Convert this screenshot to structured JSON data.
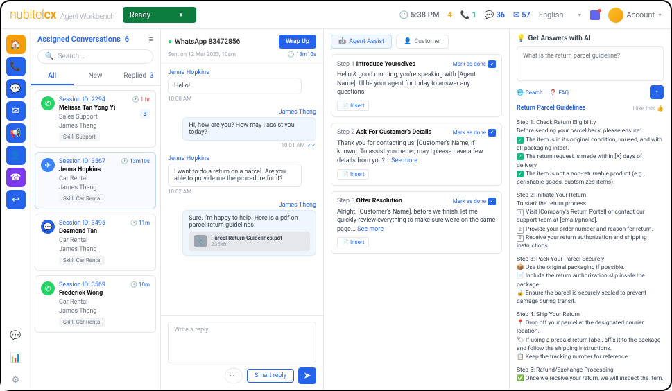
{
  "header": {
    "brand": "nubitel",
    "brand_suffix": "cx",
    "product": "Agent Workbench",
    "status": "Ready",
    "time_label": "5:38 PM",
    "stat_pending": "4",
    "stat_calls": "1",
    "stat_chats": "36",
    "stat_emails": "57",
    "language": "English",
    "account_label": "Account"
  },
  "convs": {
    "title": "Assigned Conversations",
    "count": "6",
    "search_placeholder": "Search...",
    "tabs": {
      "all": "All",
      "new": "New",
      "replied": "Replied",
      "replied_cnt": "3"
    },
    "items": [
      {
        "channel": "wa",
        "session": "Session ID: 2294",
        "time": "1 hr",
        "time_red": true,
        "name": "Melissa Tan Yong Yi",
        "sub1": "Sales Support",
        "sub2": "James Theng",
        "skill": "Skill: Support",
        "unread": "3"
      },
      {
        "channel": "tg",
        "session": "Session ID: 3567",
        "time": "13m10s",
        "name": "Jenna Hopkins",
        "sub1": "Car Rental",
        "sub2": "James Theng",
        "skill": "Skill: Car Rental",
        "selected": true
      },
      {
        "channel": "ms",
        "session": "Session ID: 3495",
        "time": "11m",
        "name": "Desmond Tan",
        "sub1": "Car Rental",
        "sub2": "James Theng",
        "skill": "Skill: Car Rental"
      },
      {
        "channel": "wa",
        "session": "Session ID: 3569",
        "time": "10m",
        "name": "Frederick Wong",
        "sub1": "Car Rental",
        "sub2": "James Theng",
        "skill": "Skill: Car Rental"
      }
    ]
  },
  "chat": {
    "title": "WhatsApp 83472856",
    "wrap_label": "Wrap Up",
    "sent_meta": "Sent on 12 Mar 2023, 10am",
    "timer": "13m10s",
    "messages": [
      {
        "dir": "in",
        "name": "Jenna Hopkins",
        "text": "Hello!",
        "time": "10:00 AM"
      },
      {
        "dir": "out",
        "name": "James Theng",
        "text": "Hi, how are you? How may I assist you today?",
        "time": "10:01 AM",
        "checks": true
      },
      {
        "dir": "in",
        "name": "Jenna Hopkins",
        "text": "I want to do a return on a parcel. Are you able to provide me the procedure for it?",
        "time": "10:02 AM"
      },
      {
        "dir": "out",
        "name": "James Theng",
        "text": "Sure, I'm happy to help. Here is a pdf on parcel return guidelines.",
        "file": {
          "name": "Parcel Return Guidelines.pdf",
          "size": "235kb"
        }
      }
    ],
    "reply_placeholder": "Write a reply",
    "smart_label": "Smart reply"
  },
  "assist": {
    "tab_agent": "Agent Assist",
    "tab_customer": "Customer",
    "steps": [
      {
        "no": "Step 1",
        "title": "Introduce Yourselves",
        "text": "Hello & good morning, you're speaking with [Agent Name]. I'll be your agent for today to answer any questions.",
        "mark": "Mark as done"
      },
      {
        "no": "Step 2",
        "title": "Ask For Customer's Details",
        "text": "Thank you for contacting us, [Customer's Name, if known]. To assist you better, may I please have a few details from you?... ",
        "more": "See more",
        "mark": "Mark as done"
      },
      {
        "no": "Step 3",
        "title": "Offer Resolution",
        "text": "Alright, [Customer's Name], before we finish, let me quickly review everything to make sure we're on the same page... ",
        "more": "See more",
        "mark": "Mark as done"
      }
    ],
    "insert_label": "Insert"
  },
  "ai": {
    "title": "Get Answers with AI",
    "question": "What is the return parcel guideline?",
    "opt_search": "Search",
    "opt_faq": "FAQ",
    "res_title": "Return Parcel Guidelines",
    "like_label": "I like this",
    "body": {
      "s1_t": "Step 1: Check Return Eligibility",
      "s1_l": "Before sending your parcel back, please ensure:",
      "s1_a": "The item is in its original condition, unused, and with all packaging intact.",
      "s1_b": "The return request is made within [X] days of delivery.",
      "s1_c": "The item is not a non-returnable product (e.g., perishable goods, customized items).",
      "s2_t": "Step 2: Initiate Your Return",
      "s2_l": "To start the return process:",
      "s2_a": "Visit [Company's Return Portal] or contact our support team at [email/phone].",
      "s2_b": "Provide your order number and reason for return.",
      "s2_c": "Receive your return authorization and shipping instructions.",
      "s3_t": "Step 3: Pack Your Parcel Securely",
      "s3_a": "Use the original packaging if possible.",
      "s3_b": "Include the return authorization slip inside the package.",
      "s3_c": "Ensure the parcel is securely sealed to prevent damage during transit.",
      "s4_t": "Step 4: Ship Your Return",
      "s4_a": "Drop off your parcel at the designated courier location.",
      "s4_b": "If using a prepaid return label, affix it to the package and follow the shipping instructions.",
      "s4_c": "Keep the tracking number for reference.",
      "s5_t": "Step 5: Refund/Exchange Processing",
      "s5_a": "Once we receive your return, we will inspect the item."
    }
  }
}
